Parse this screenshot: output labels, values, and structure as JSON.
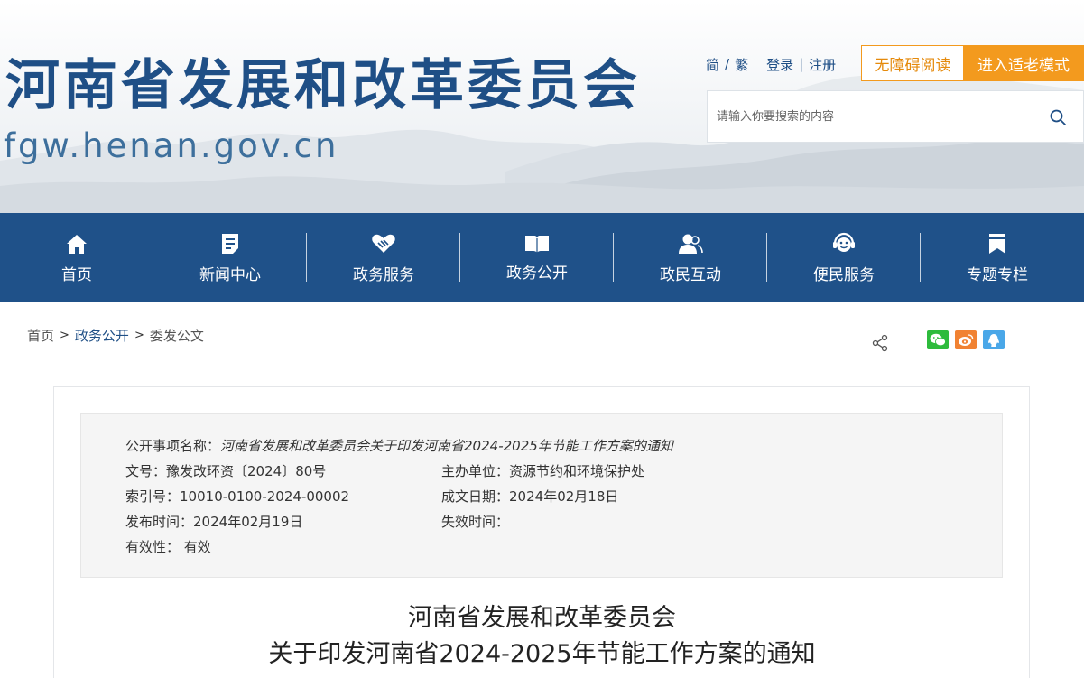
{
  "header": {
    "title": "河南省发展和改革委员会",
    "domain": "fgw.henan.gov.cn",
    "lang_simplified": "简",
    "lang_separator": "/",
    "lang_traditional": "繁",
    "login": "登录",
    "login_separator": "|",
    "register": "注册",
    "accessible_reading": "无障碍阅读",
    "elder_mode": "进入适老模式",
    "search_placeholder": "请输入你要搜索的内容"
  },
  "nav": {
    "items": [
      {
        "label": "首页",
        "icon": "home-icon"
      },
      {
        "label": "新闻中心",
        "icon": "news-icon"
      },
      {
        "label": "政务服务",
        "icon": "handshake-icon"
      },
      {
        "label": "政务公开",
        "icon": "book-icon"
      },
      {
        "label": "政民互动",
        "icon": "people-icon"
      },
      {
        "label": "便民服务",
        "icon": "service-icon"
      },
      {
        "label": "专题专栏",
        "icon": "bookmark-icon"
      }
    ]
  },
  "breadcrumb": {
    "home": "首页",
    "arrow": ">",
    "level1": "政务公开",
    "level2": "委发公文"
  },
  "share": {
    "share_icon": "share-icon",
    "wechat_icon": "wechat-icon",
    "weibo_icon": "weibo-icon",
    "qq_icon": "qq-icon"
  },
  "meta": {
    "item_name_label": "公开事项名称：",
    "item_name_value": "河南省发展和改革委员会关于印发河南省2024-2025年节能工作方案的通知",
    "doc_no_label": "文号：",
    "doc_no_value": "豫发改环资〔2024〕80号",
    "host_unit_label": "主办单位：",
    "host_unit_value": "资源节约和环境保护处",
    "index_no_label": "索引号：",
    "index_no_value": "10010-0100-2024-00002",
    "written_date_label": "成文日期：",
    "written_date_value": "2024年02月18日",
    "publish_time_label": "发布时间：",
    "publish_time_value": "2024年02月19日",
    "expire_time_label": "失效时间：",
    "expire_time_value": "",
    "validity_label": "有效性：",
    "validity_value": "有效"
  },
  "document": {
    "title_line1": "河南省发展和改革委员会",
    "title_line2": "关于印发河南省2024-2025年节能工作方案的通知"
  },
  "colors": {
    "brand_blue": "#1f5189",
    "accent_orange": "#f39a1e"
  }
}
